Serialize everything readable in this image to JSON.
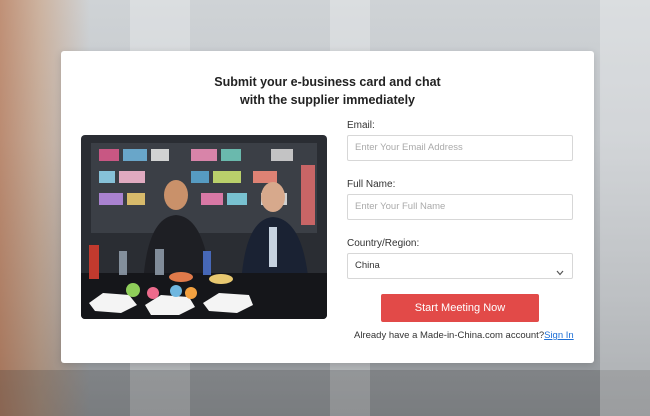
{
  "modal": {
    "title_line1": "Submit your e-business card and chat",
    "title_line2": "with the supplier immediately"
  },
  "form": {
    "email_label": "Email:",
    "email_placeholder": "Enter Your Email Address",
    "name_label": "Full Name:",
    "name_placeholder": "Enter Your Full Name",
    "country_label": "Country/Region:",
    "country_value": "China",
    "submit_label": "Start Meeting Now",
    "account_text": "Already have a Made-in-China.com account?",
    "sign_in_label": "Sign In"
  },
  "colors": {
    "accent": "#e24a48",
    "link": "#1d6fd6"
  }
}
